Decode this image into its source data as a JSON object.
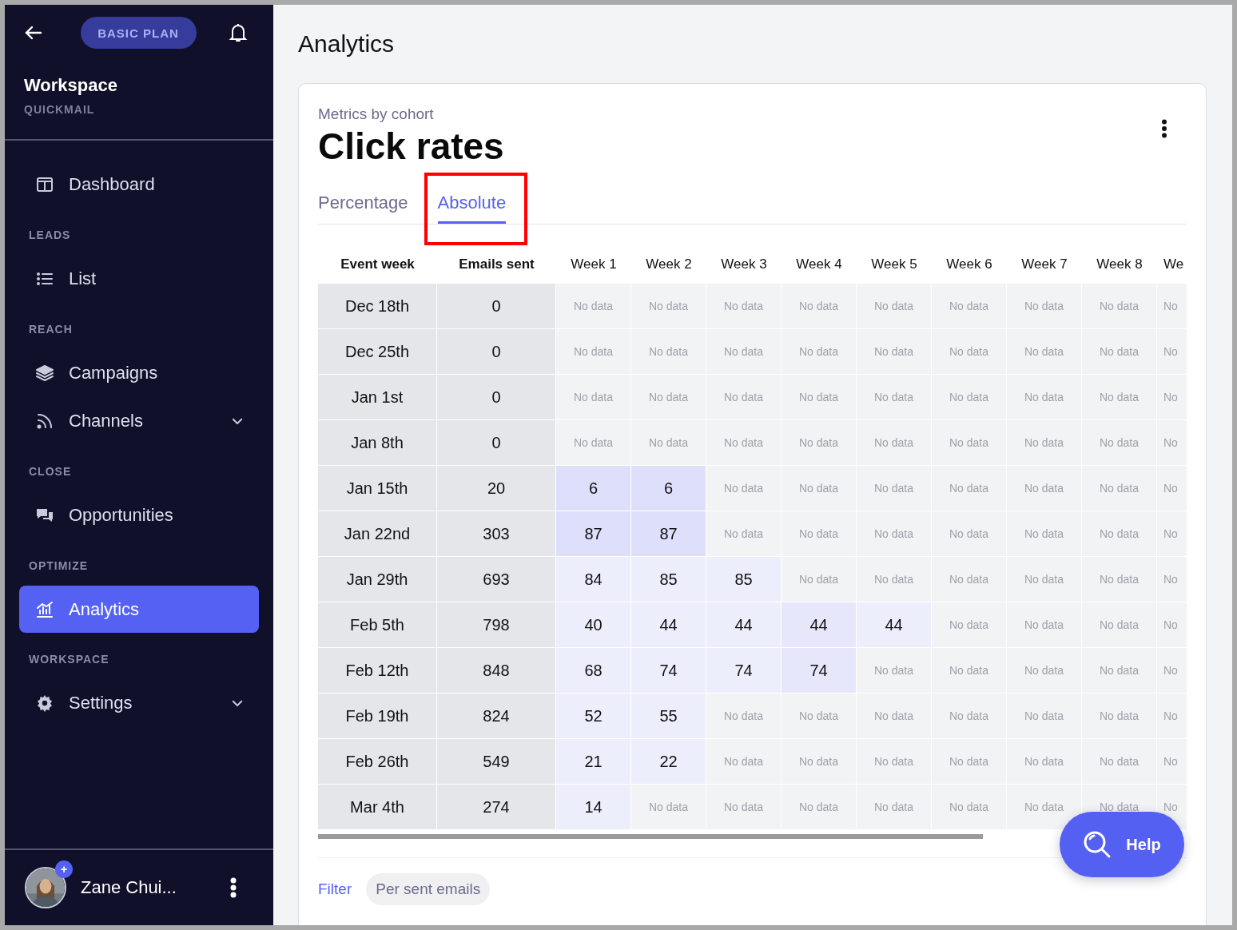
{
  "sidebar": {
    "plan": "BASIC PLAN",
    "workspace": "Workspace",
    "org": "QUICKMAIL",
    "nav": [
      {
        "kind": "item",
        "label": "Dashboard",
        "selected": false
      },
      {
        "kind": "section",
        "label": "LEADS"
      },
      {
        "kind": "item",
        "label": "List",
        "selected": false
      },
      {
        "kind": "section",
        "label": "REACH"
      },
      {
        "kind": "item",
        "label": "Campaigns",
        "selected": false
      },
      {
        "kind": "item",
        "label": "Channels",
        "selected": false,
        "expanded": false
      },
      {
        "kind": "section",
        "label": "CLOSE"
      },
      {
        "kind": "item",
        "label": "Opportunities",
        "selected": false
      },
      {
        "kind": "section",
        "label": "OPTIMIZE"
      },
      {
        "kind": "item",
        "label": "Analytics",
        "selected": true
      },
      {
        "kind": "section",
        "label": "WORKSPACE"
      },
      {
        "kind": "item",
        "label": "Settings",
        "selected": false,
        "expanded": false
      }
    ],
    "user": {
      "name": "Zane Chui...",
      "badge": "+"
    }
  },
  "page": {
    "title": "Analytics"
  },
  "card": {
    "subtitle": "Metrics by cohort",
    "title": "Click rates",
    "tabs": [
      {
        "label": "Percentage",
        "selected": false,
        "highlighted": false
      },
      {
        "label": "Absolute",
        "selected": true,
        "highlighted": true
      }
    ],
    "table": {
      "columns": [
        "Event week",
        "Emails sent",
        "Week 1",
        "Week 2",
        "Week 3",
        "Week 4",
        "Week 5",
        "Week 6",
        "Week 7",
        "Week 8",
        "We"
      ],
      "rows": [
        {
          "cells": [
            {
              "text": "Dec 18th",
              "kind": "label"
            },
            {
              "text": "0",
              "kind": "label"
            },
            {
              "text": "No data",
              "kind": "empty"
            },
            {
              "text": "No data",
              "kind": "empty"
            },
            {
              "text": "No data",
              "kind": "empty"
            },
            {
              "text": "No data",
              "kind": "empty"
            },
            {
              "text": "No data",
              "kind": "empty"
            },
            {
              "text": "No data",
              "kind": "empty"
            },
            {
              "text": "No data",
              "kind": "empty"
            },
            {
              "text": "No data",
              "kind": "empty"
            },
            {
              "text": "No",
              "kind": "empty"
            }
          ]
        },
        {
          "cells": [
            {
              "text": "Dec 25th",
              "kind": "label"
            },
            {
              "text": "0",
              "kind": "label"
            },
            {
              "text": "No data",
              "kind": "empty"
            },
            {
              "text": "No data",
              "kind": "empty"
            },
            {
              "text": "No data",
              "kind": "empty"
            },
            {
              "text": "No data",
              "kind": "empty"
            },
            {
              "text": "No data",
              "kind": "empty"
            },
            {
              "text": "No data",
              "kind": "empty"
            },
            {
              "text": "No data",
              "kind": "empty"
            },
            {
              "text": "No data",
              "kind": "empty"
            },
            {
              "text": "No",
              "kind": "empty"
            }
          ]
        },
        {
          "cells": [
            {
              "text": "Jan 1st",
              "kind": "label"
            },
            {
              "text": "0",
              "kind": "label"
            },
            {
              "text": "No data",
              "kind": "empty"
            },
            {
              "text": "No data",
              "kind": "empty"
            },
            {
              "text": "No data",
              "kind": "empty"
            },
            {
              "text": "No data",
              "kind": "empty"
            },
            {
              "text": "No data",
              "kind": "empty"
            },
            {
              "text": "No data",
              "kind": "empty"
            },
            {
              "text": "No data",
              "kind": "empty"
            },
            {
              "text": "No data",
              "kind": "empty"
            },
            {
              "text": "No",
              "kind": "empty"
            }
          ]
        },
        {
          "cells": [
            {
              "text": "Jan 8th",
              "kind": "label"
            },
            {
              "text": "0",
              "kind": "label"
            },
            {
              "text": "No data",
              "kind": "empty"
            },
            {
              "text": "No data",
              "kind": "empty"
            },
            {
              "text": "No data",
              "kind": "empty"
            },
            {
              "text": "No data",
              "kind": "empty"
            },
            {
              "text": "No data",
              "kind": "empty"
            },
            {
              "text": "No data",
              "kind": "empty"
            },
            {
              "text": "No data",
              "kind": "empty"
            },
            {
              "text": "No data",
              "kind": "empty"
            },
            {
              "text": "No",
              "kind": "empty"
            }
          ]
        },
        {
          "cells": [
            {
              "text": "Jan 15th",
              "kind": "label"
            },
            {
              "text": "20",
              "kind": "label"
            },
            {
              "text": "6",
              "kind": "strong"
            },
            {
              "text": "6",
              "kind": "strong"
            },
            {
              "text": "No data",
              "kind": "empty"
            },
            {
              "text": "No data",
              "kind": "empty"
            },
            {
              "text": "No data",
              "kind": "empty"
            },
            {
              "text": "No data",
              "kind": "empty"
            },
            {
              "text": "No data",
              "kind": "empty"
            },
            {
              "text": "No data",
              "kind": "empty"
            },
            {
              "text": "No",
              "kind": "empty"
            }
          ]
        },
        {
          "cells": [
            {
              "text": "Jan 22nd",
              "kind": "label"
            },
            {
              "text": "303",
              "kind": "label"
            },
            {
              "text": "87",
              "kind": "strong"
            },
            {
              "text": "87",
              "kind": "strong"
            },
            {
              "text": "No data",
              "kind": "empty"
            },
            {
              "text": "No data",
              "kind": "empty"
            },
            {
              "text": "No data",
              "kind": "empty"
            },
            {
              "text": "No data",
              "kind": "empty"
            },
            {
              "text": "No data",
              "kind": "empty"
            },
            {
              "text": "No data",
              "kind": "empty"
            },
            {
              "text": "No",
              "kind": "empty"
            }
          ]
        },
        {
          "cells": [
            {
              "text": "Jan 29th",
              "kind": "label"
            },
            {
              "text": "693",
              "kind": "label"
            },
            {
              "text": "84",
              "kind": "light"
            },
            {
              "text": "85",
              "kind": "light"
            },
            {
              "text": "85",
              "kind": "light"
            },
            {
              "text": "No data",
              "kind": "empty"
            },
            {
              "text": "No data",
              "kind": "empty"
            },
            {
              "text": "No data",
              "kind": "empty"
            },
            {
              "text": "No data",
              "kind": "empty"
            },
            {
              "text": "No data",
              "kind": "empty"
            },
            {
              "text": "No",
              "kind": "empty"
            }
          ]
        },
        {
          "cells": [
            {
              "text": "Feb 5th",
              "kind": "label"
            },
            {
              "text": "798",
              "kind": "label"
            },
            {
              "text": "40",
              "kind": "light"
            },
            {
              "text": "44",
              "kind": "light"
            },
            {
              "text": "44",
              "kind": "light"
            },
            {
              "text": "44",
              "kind": "medium"
            },
            {
              "text": "44",
              "kind": "light"
            },
            {
              "text": "No data",
              "kind": "empty"
            },
            {
              "text": "No data",
              "kind": "empty"
            },
            {
              "text": "No data",
              "kind": "empty"
            },
            {
              "text": "No",
              "kind": "empty"
            }
          ]
        },
        {
          "cells": [
            {
              "text": "Feb 12th",
              "kind": "label"
            },
            {
              "text": "848",
              "kind": "label"
            },
            {
              "text": "68",
              "kind": "light"
            },
            {
              "text": "74",
              "kind": "light"
            },
            {
              "text": "74",
              "kind": "light"
            },
            {
              "text": "74",
              "kind": "medium"
            },
            {
              "text": "No data",
              "kind": "empty"
            },
            {
              "text": "No data",
              "kind": "empty"
            },
            {
              "text": "No data",
              "kind": "empty"
            },
            {
              "text": "No data",
              "kind": "empty"
            },
            {
              "text": "No",
              "kind": "empty"
            }
          ]
        },
        {
          "cells": [
            {
              "text": "Feb 19th",
              "kind": "label"
            },
            {
              "text": "824",
              "kind": "label"
            },
            {
              "text": "52",
              "kind": "light"
            },
            {
              "text": "55",
              "kind": "light"
            },
            {
              "text": "No data",
              "kind": "empty"
            },
            {
              "text": "No data",
              "kind": "empty"
            },
            {
              "text": "No data",
              "kind": "empty"
            },
            {
              "text": "No data",
              "kind": "empty"
            },
            {
              "text": "No data",
              "kind": "empty"
            },
            {
              "text": "No data",
              "kind": "empty"
            },
            {
              "text": "No",
              "kind": "empty"
            }
          ]
        },
        {
          "cells": [
            {
              "text": "Feb 26th",
              "kind": "label"
            },
            {
              "text": "549",
              "kind": "label"
            },
            {
              "text": "21",
              "kind": "light"
            },
            {
              "text": "22",
              "kind": "light"
            },
            {
              "text": "No data",
              "kind": "empty"
            },
            {
              "text": "No data",
              "kind": "empty"
            },
            {
              "text": "No data",
              "kind": "empty"
            },
            {
              "text": "No data",
              "kind": "empty"
            },
            {
              "text": "No data",
              "kind": "empty"
            },
            {
              "text": "No data",
              "kind": "empty"
            },
            {
              "text": "No",
              "kind": "empty"
            }
          ]
        },
        {
          "cells": [
            {
              "text": "Mar 4th",
              "kind": "label"
            },
            {
              "text": "274",
              "kind": "label"
            },
            {
              "text": "14",
              "kind": "light"
            },
            {
              "text": "No data",
              "kind": "empty"
            },
            {
              "text": "No data",
              "kind": "empty"
            },
            {
              "text": "No data",
              "kind": "empty"
            },
            {
              "text": "No data",
              "kind": "empty"
            },
            {
              "text": "No data",
              "kind": "empty"
            },
            {
              "text": "No data",
              "kind": "empty"
            },
            {
              "text": "No data",
              "kind": "empty"
            },
            {
              "text": "No",
              "kind": "empty"
            }
          ]
        }
      ]
    },
    "footer": {
      "link": "Filter",
      "chip": "Per sent emails"
    }
  },
  "help": {
    "label": "Help"
  }
}
